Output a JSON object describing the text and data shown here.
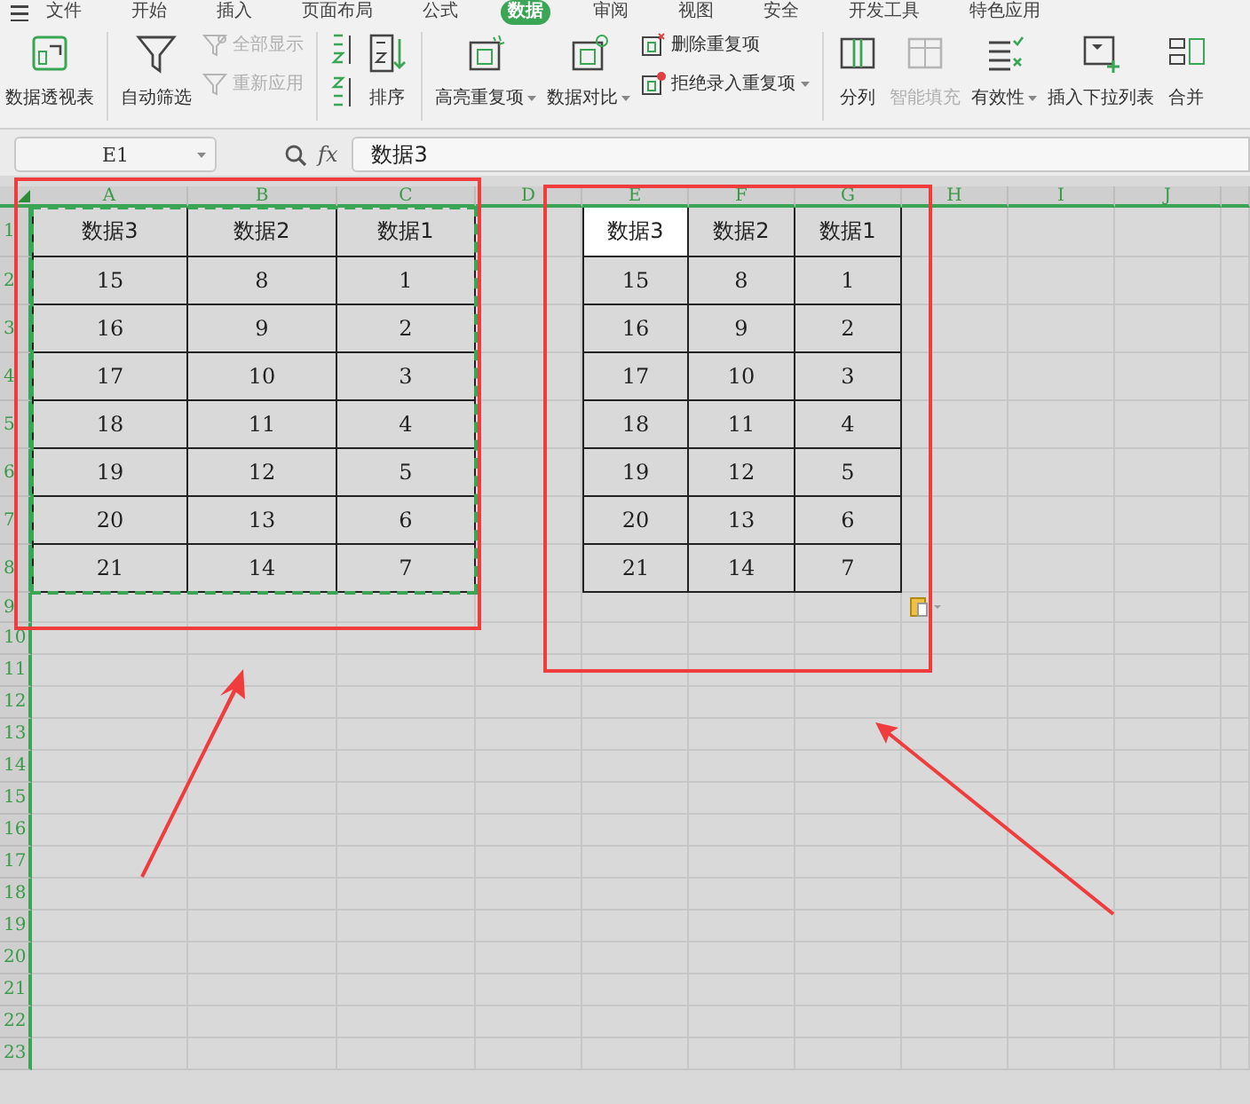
{
  "menu_tabs": [
    {
      "label": "文件",
      "selected": false
    },
    {
      "label": "开始",
      "selected": false
    },
    {
      "label": "插入",
      "selected": false
    },
    {
      "label": "页面布局",
      "selected": false
    },
    {
      "label": "公式",
      "selected": false
    },
    {
      "label": "数据",
      "selected": true
    },
    {
      "label": "审阅",
      "selected": false
    },
    {
      "label": "视图",
      "selected": false
    },
    {
      "label": "安全",
      "selected": false
    },
    {
      "label": "开发工具",
      "selected": false
    },
    {
      "label": "特色应用",
      "selected": false
    }
  ],
  "ribbon": [
    {
      "kind": "large",
      "label": "数据透视表",
      "disabled": false,
      "dropdown": false
    },
    {
      "kind": "separator"
    },
    {
      "kind": "large",
      "label": "自动筛选",
      "disabled": false,
      "dropdown": false
    },
    {
      "kind": "stack",
      "items": [
        {
          "label": "全部显示",
          "disabled": true,
          "dropdown": false
        },
        {
          "label": "重新应用",
          "disabled": true,
          "dropdown": false
        }
      ]
    },
    {
      "kind": "separator"
    },
    {
      "kind": "sort-pair"
    },
    {
      "kind": "large",
      "label": "排序",
      "disabled": false,
      "dropdown": false
    },
    {
      "kind": "separator"
    },
    {
      "kind": "large",
      "label": "高亮重复项",
      "disabled": false,
      "dropdown": true
    },
    {
      "kind": "large",
      "label": "数据对比",
      "disabled": false,
      "dropdown": true
    },
    {
      "kind": "stack",
      "items": [
        {
          "label": "删除重复项",
          "disabled": false,
          "dropdown": false
        },
        {
          "label": "拒绝录入重复项",
          "disabled": false,
          "dropdown": true
        }
      ]
    },
    {
      "kind": "separator"
    },
    {
      "kind": "large",
      "label": "分列",
      "disabled": false,
      "dropdown": false
    },
    {
      "kind": "large",
      "label": "智能填充",
      "disabled": true,
      "dropdown": false
    },
    {
      "kind": "large",
      "label": "有效性",
      "disabled": false,
      "dropdown": true
    },
    {
      "kind": "large",
      "label": "插入下拉列表",
      "disabled": false,
      "dropdown": false
    },
    {
      "kind": "large",
      "label": "合并",
      "disabled": false,
      "dropdown": false
    }
  ],
  "formula_bar": {
    "cell_ref": "E1",
    "fx": "fx",
    "value": "数据3"
  },
  "sheet": {
    "columns": [
      "A",
      "B",
      "C",
      "D",
      "E",
      "F",
      "G",
      "H",
      "I",
      "J"
    ],
    "rows": [
      "1",
      "2",
      "3",
      "4",
      "5",
      "6",
      "7",
      "8",
      "9",
      "10",
      "11",
      "12",
      "13",
      "14",
      "15",
      "16",
      "17",
      "18",
      "19",
      "20",
      "21",
      "22",
      "23"
    ],
    "source_table": {
      "copied": true,
      "header": [
        {
          "text": "数据3",
          "selected": false
        },
        {
          "text": "数据2",
          "selected": false
        },
        {
          "text": "数据1",
          "selected": false
        }
      ],
      "rows": [
        [
          "15",
          "8",
          "1"
        ],
        [
          "16",
          "9",
          "2"
        ],
        [
          "17",
          "10",
          "3"
        ],
        [
          "18",
          "11",
          "4"
        ],
        [
          "19",
          "12",
          "5"
        ],
        [
          "20",
          "13",
          "6"
        ],
        [
          "21",
          "14",
          "7"
        ]
      ]
    },
    "pasted_table": {
      "copied": false,
      "header": [
        {
          "text": "数据3",
          "selected": true
        },
        {
          "text": "数据2",
          "selected": false
        },
        {
          "text": "数据1",
          "selected": false
        }
      ],
      "rows": [
        [
          "15",
          "8",
          "1"
        ],
        [
          "16",
          "9",
          "2"
        ],
        [
          "17",
          "10",
          "3"
        ],
        [
          "18",
          "11",
          "4"
        ],
        [
          "19",
          "12",
          "5"
        ],
        [
          "20",
          "13",
          "6"
        ],
        [
          "21",
          "14",
          "7"
        ]
      ]
    }
  }
}
